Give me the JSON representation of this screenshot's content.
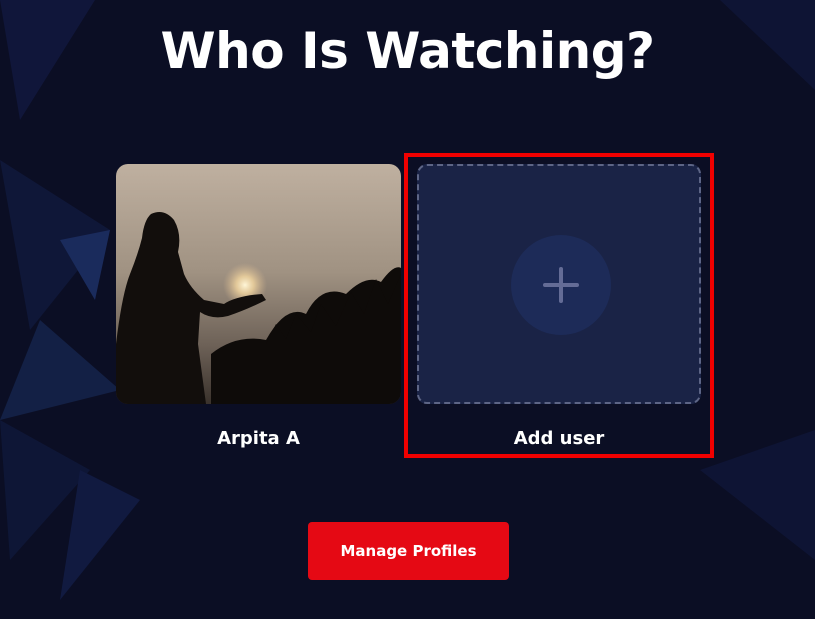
{
  "header": {
    "title": "Who Is Watching?"
  },
  "profiles": [
    {
      "name": "Arpita A",
      "avatar": "silhouette-sunset-photo"
    }
  ],
  "add_profile": {
    "label": "Add user",
    "icon": "plus-icon"
  },
  "actions": {
    "manage_label": "Manage Profiles"
  },
  "colors": {
    "background": "#0b0e24",
    "accent": "#e50914",
    "highlight": "#f00000",
    "add_card": "#1a2346"
  }
}
